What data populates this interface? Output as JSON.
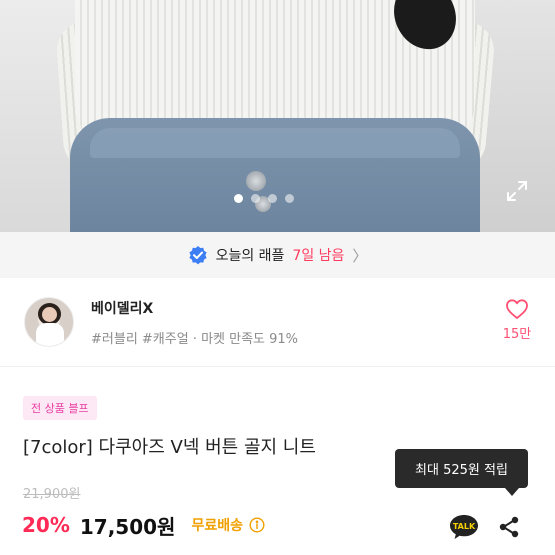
{
  "product_image": {
    "carousel": {
      "total": 4,
      "active_index": 1
    }
  },
  "raffle": {
    "label": "오늘의 래플",
    "remaining": "7일 남음",
    "chevron": "〉"
  },
  "shop": {
    "name": "베이델리X",
    "tags": "#러블리 #캐주얼 · 마켓 만족도 91%",
    "likes": "15만"
  },
  "product": {
    "promo_badge": "전 상품 블프",
    "title": "[7color] 다쿠아즈 V넥 버튼 골지 니트",
    "original_price": "21,900원",
    "discount": "20%",
    "price": "17,500원",
    "shipping": "무료배송"
  },
  "tooltip": {
    "text": "최대 525원 적립"
  },
  "actions": {
    "talk_label": "TALK"
  },
  "colors": {
    "accent_red": "#ff2a55",
    "raffle_red": "#ff3b5f",
    "promo_pink": "#ea3ea1",
    "shipping_orange": "#f0a000",
    "verified_blue": "#3d7ef5",
    "talk_yellow": "#222222"
  },
  "icons": {
    "expand": "expand-icon",
    "verified": "verified-badge-icon",
    "heart": "heart-icon",
    "info": "info-icon",
    "talk": "talk-icon",
    "share": "share-icon"
  }
}
